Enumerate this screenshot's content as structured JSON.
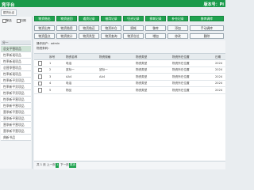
{
  "app": {
    "title": "竞平台",
    "version": "版本号：Pi"
  },
  "left_toolbar": {
    "button": "银货出证"
  },
  "sidebar": {
    "check1_label": "筛选",
    "check2_label": "日期",
    "group_label": "分一",
    "items": [
      "总支平营项品",
      "性率新现项品",
      "性率新现项品",
      "总营季营项品",
      "性率新现项品",
      "性率新平贡项品",
      "性率新平贡项品",
      "性季新平贡项品",
      "性季新平营项品",
      "性季新平营项品",
      "营季新平营项品",
      "营季新平营项品",
      "营季新平营项品",
      "营季新平营项品",
      "典新书品"
    ]
  },
  "toolbar_rows": [
    [
      "物资借出",
      "物资退回",
      "通资记录",
      "借用记录",
      "归还记录",
      "损耗记录",
      "补仓记录",
      "移库调库"
    ],
    [
      "物资出库",
      "物资借用",
      "物资借还",
      "物资补仓",
      "损耗",
      "移库",
      "添加",
      "手动调库"
    ],
    [
      "物资盘点",
      "物资统计",
      "物资类型",
      "物资查询",
      "物资仓位",
      "增加",
      "修改",
      "删除"
    ]
  ],
  "info": {
    "line1": "操作用户：admin",
    "line2": "物资条码："
  },
  "table": {
    "headers": [
      "序号",
      "物资名称",
      "物资规格",
      "物资类型",
      "物资所在位置",
      "日期"
    ],
    "rows": [
      {
        "idx": "1",
        "name": "电话",
        "spec": "",
        "type": "物资类型",
        "loc": "物资所在位置",
        "date": "2024"
      },
      {
        "idx": "2",
        "name": "鼠标一",
        "spec": "鼠标一",
        "type": "物资类型",
        "loc": "物资所在位置",
        "date": "2024"
      },
      {
        "idx": "3",
        "name": "AA4",
        "spec": "AA4",
        "type": "物资类型",
        "loc": "物资所在位置",
        "date": "2024"
      },
      {
        "idx": "4",
        "name": "电话",
        "spec": "",
        "type": "物资类型",
        "loc": "物资所在位置",
        "date": "2024"
      },
      {
        "idx": "5",
        "name": "物品",
        "spec": "",
        "type": "物资类型",
        "loc": "物资所在位置",
        "date": "2024"
      }
    ]
  },
  "pager": {
    "page_info": "共 1 页",
    "prev": "上一页",
    "current": "1",
    "next": "下一页",
    "last": "尾页"
  }
}
